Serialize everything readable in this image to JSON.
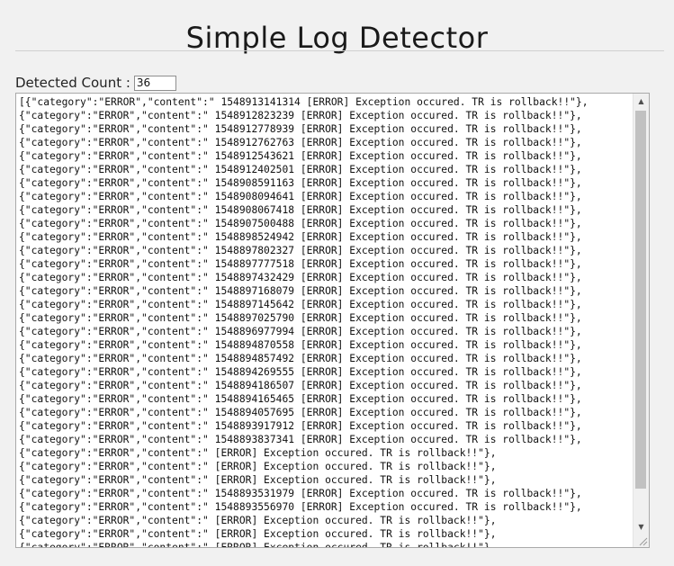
{
  "page": {
    "title": "Simple Log Detector"
  },
  "counter": {
    "label": "Detected Count :",
    "value": "36"
  },
  "log": {
    "lines": [
      "[{\"category\":\"ERROR\",\"content\":\" 1548913141314 [ERROR] Exception occured. TR is rollback!!\"},",
      "{\"category\":\"ERROR\",\"content\":\" 1548912823239 [ERROR] Exception occured. TR is rollback!!\"},",
      "{\"category\":\"ERROR\",\"content\":\" 1548912778939 [ERROR] Exception occured. TR is rollback!!\"},",
      "{\"category\":\"ERROR\",\"content\":\" 1548912762763 [ERROR] Exception occured. TR is rollback!!\"},",
      "{\"category\":\"ERROR\",\"content\":\" 1548912543621 [ERROR] Exception occured. TR is rollback!!\"},",
      "{\"category\":\"ERROR\",\"content\":\" 1548912402501 [ERROR] Exception occured. TR is rollback!!\"},",
      "{\"category\":\"ERROR\",\"content\":\" 1548908591163 [ERROR] Exception occured. TR is rollback!!\"},",
      "{\"category\":\"ERROR\",\"content\":\" 1548908094641 [ERROR] Exception occured. TR is rollback!!\"},",
      "{\"category\":\"ERROR\",\"content\":\" 1548908067418 [ERROR] Exception occured. TR is rollback!!\"},",
      "{\"category\":\"ERROR\",\"content\":\" 1548907500488 [ERROR] Exception occured. TR is rollback!!\"},",
      "{\"category\":\"ERROR\",\"content\":\" 1548898524942 [ERROR] Exception occured. TR is rollback!!\"},",
      "{\"category\":\"ERROR\",\"content\":\" 1548897802327 [ERROR] Exception occured. TR is rollback!!\"},",
      "{\"category\":\"ERROR\",\"content\":\" 1548897777518 [ERROR] Exception occured. TR is rollback!!\"},",
      "{\"category\":\"ERROR\",\"content\":\" 1548897432429 [ERROR] Exception occured. TR is rollback!!\"},",
      "{\"category\":\"ERROR\",\"content\":\" 1548897168079 [ERROR] Exception occured. TR is rollback!!\"},",
      "{\"category\":\"ERROR\",\"content\":\" 1548897145642 [ERROR] Exception occured. TR is rollback!!\"},",
      "{\"category\":\"ERROR\",\"content\":\" 1548897025790 [ERROR] Exception occured. TR is rollback!!\"},",
      "{\"category\":\"ERROR\",\"content\":\" 1548896977994 [ERROR] Exception occured. TR is rollback!!\"},",
      "{\"category\":\"ERROR\",\"content\":\" 1548894870558 [ERROR] Exception occured. TR is rollback!!\"},",
      "{\"category\":\"ERROR\",\"content\":\" 1548894857492 [ERROR] Exception occured. TR is rollback!!\"},",
      "{\"category\":\"ERROR\",\"content\":\" 1548894269555 [ERROR] Exception occured. TR is rollback!!\"},",
      "{\"category\":\"ERROR\",\"content\":\" 1548894186507 [ERROR] Exception occured. TR is rollback!!\"},",
      "{\"category\":\"ERROR\",\"content\":\" 1548894165465 [ERROR] Exception occured. TR is rollback!!\"},",
      "{\"category\":\"ERROR\",\"content\":\" 1548894057695 [ERROR] Exception occured. TR is rollback!!\"},",
      "{\"category\":\"ERROR\",\"content\":\" 1548893917912 [ERROR] Exception occured. TR is rollback!!\"},",
      "{\"category\":\"ERROR\",\"content\":\" 1548893837341 [ERROR] Exception occured. TR is rollback!!\"},",
      "{\"category\":\"ERROR\",\"content\":\" [ERROR] Exception occured. TR is rollback!!\"},",
      "{\"category\":\"ERROR\",\"content\":\" [ERROR] Exception occured. TR is rollback!!\"},",
      "{\"category\":\"ERROR\",\"content\":\" [ERROR] Exception occured. TR is rollback!!\"},",
      "{\"category\":\"ERROR\",\"content\":\" 1548893531979 [ERROR] Exception occured. TR is rollback!!\"},",
      "{\"category\":\"ERROR\",\"content\":\" 1548893556970 [ERROR] Exception occured. TR is rollback!!\"},",
      "{\"category\":\"ERROR\",\"content\":\" [ERROR] Exception occured. TR is rollback!!\"},",
      "{\"category\":\"ERROR\",\"content\":\" [ERROR] Exception occured. TR is rollback!!\"},",
      "{\"category\":\"ERROR\",\"content\":\" [ERROR] Exception occured. TR is rollback!!\"},"
    ]
  },
  "icons": {
    "scroll_up": "scroll-up-arrow-icon",
    "scroll_down": "scroll-down-arrow-icon",
    "resize": "resize-grip-icon"
  }
}
